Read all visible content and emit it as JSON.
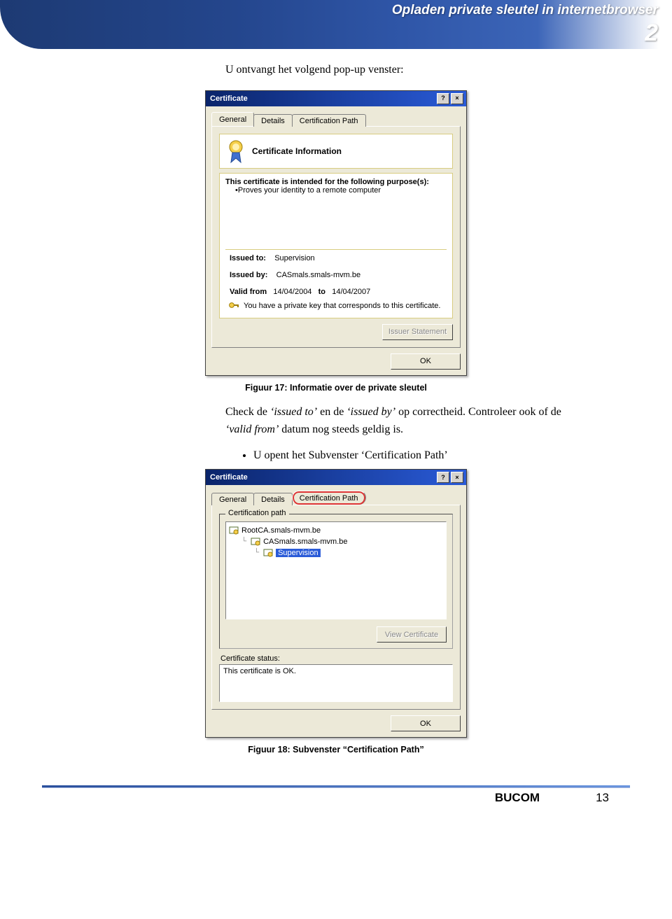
{
  "header": {
    "banner_title": "Opladen private sleutel in internetbrowser",
    "chapter_number": "2"
  },
  "intro_paragraph": "U ontvangt het volgend pop-up venster:",
  "dialog1": {
    "title": "Certificate",
    "help_btn": "?",
    "close_btn": "×",
    "tabs": {
      "general": "General",
      "details": "Details",
      "certpath": "Certification Path"
    },
    "info_heading": "Certificate Information",
    "purpose_intro": "This certificate is intended for the following purpose(s):",
    "purpose_item": "Proves your identity to a remote computer",
    "issued_to_label": "Issued to:",
    "issued_to_value": "Supervision",
    "issued_by_label": "Issued by:",
    "issued_by_value": "CASmals.smals-mvm.be",
    "valid_from_label": "Valid from",
    "valid_from_value": "14/04/2004",
    "valid_to_label": "to",
    "valid_to_value": "14/04/2007",
    "privkey_text": "You have a private key that corresponds to this certificate.",
    "issuer_statement_btn": "Issuer Statement",
    "ok_btn": "OK"
  },
  "caption1": "Figuur 17: Informatie over de private sleutel",
  "para_check": {
    "t1": "Check de ",
    "i1": "‘issued to’",
    "t2": " en de ",
    "i2": "‘issued by’",
    "t3": " op correctheid. Controleer ook of de ",
    "i3": "‘valid from’",
    "t4": " datum nog steeds geldig is."
  },
  "bullet_open_certpath": "U opent het Subvenster ‘Certification Path’",
  "dialog2": {
    "title": "Certificate",
    "help_btn": "?",
    "close_btn": "×",
    "tabs": {
      "general": "General",
      "details": "Details",
      "certpath": "Certification Path"
    },
    "group_legend": "Certification path",
    "tree": {
      "n1": "RootCA.smals-mvm.be",
      "n2": "CASmals.smals-mvm.be",
      "n3": "Supervision"
    },
    "view_cert_btn": "View Certificate",
    "status_label": "Certificate status:",
    "status_value": "This certificate is OK.",
    "ok_btn": "OK"
  },
  "caption2": "Figuur 18: Subvenster “Certification Path”",
  "footer": {
    "logo": "BUCOM",
    "page": "13"
  }
}
